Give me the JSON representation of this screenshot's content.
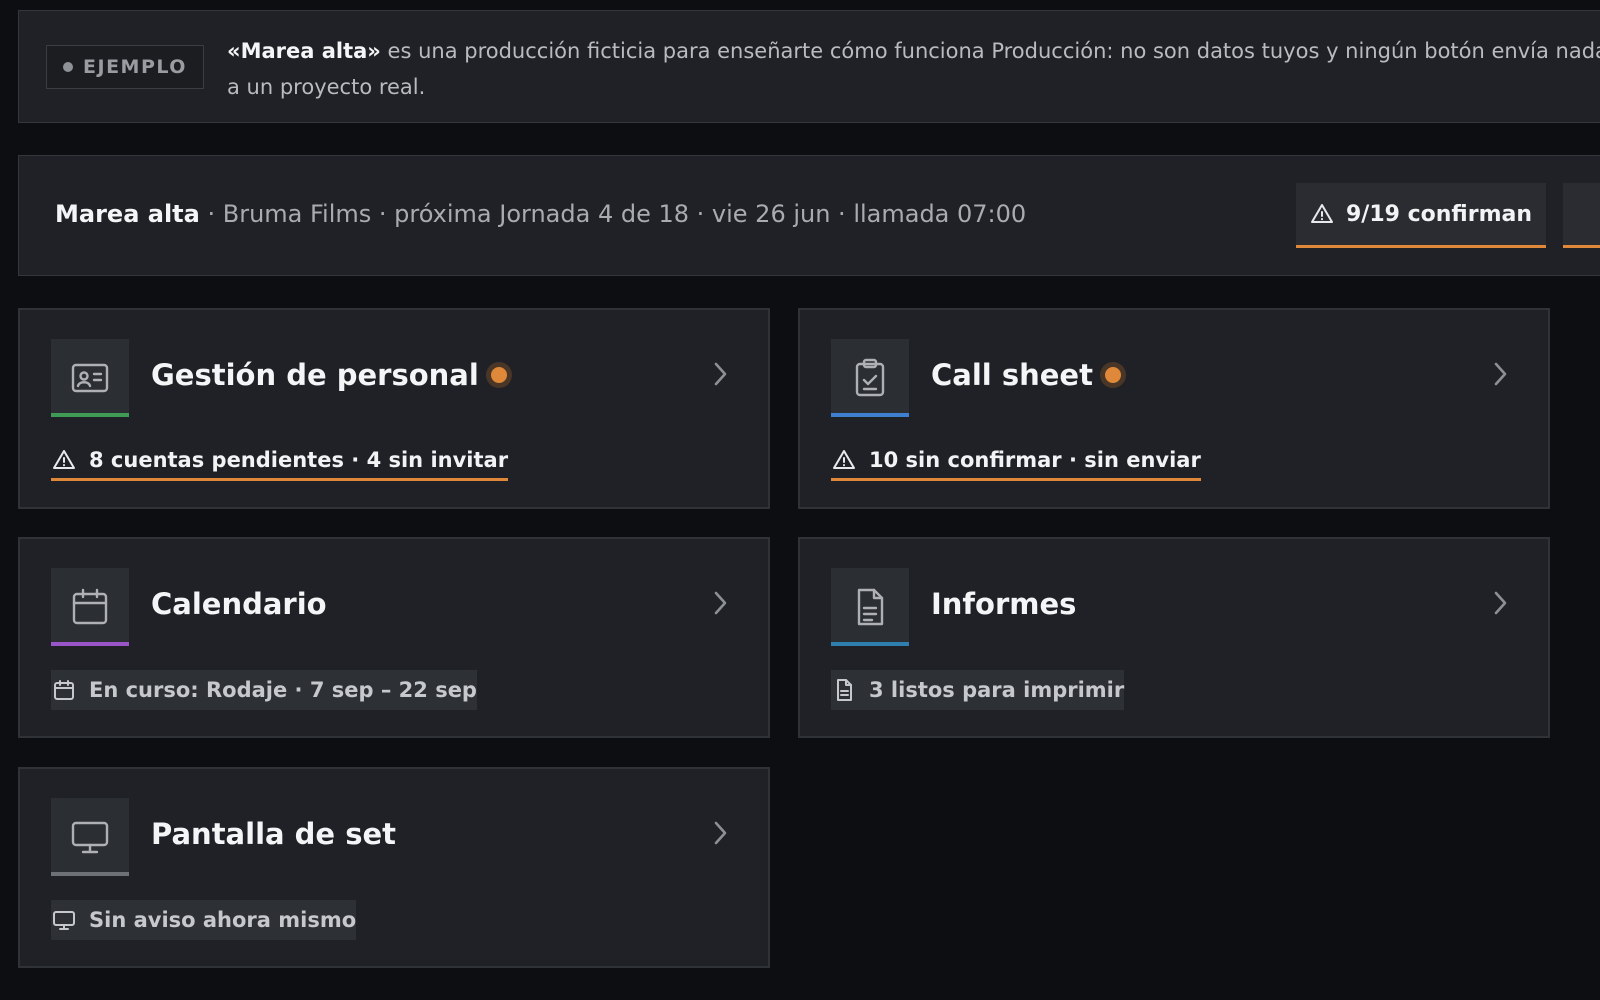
{
  "banner": {
    "chip_label": "EJEMPLO",
    "text_bold": "«Marea alta»",
    "text_rest": " es una producción ficticia para enseñarte cómo funciona Producción: no son datos tuyos y ningún botón envía nada a un proyecto real."
  },
  "header": {
    "project": "Marea alta",
    "details": " · Bruma Films · próxima Jornada 4 de 18 · vie 26 jun · llamada 07:00",
    "confirm_badge": "9/19 confirman"
  },
  "cards": [
    {
      "title": "Gestión de personal",
      "status": "8 cuentas pendientes · 4 sin invitar",
      "icon": "id-card-icon",
      "accent": "#3f9a55",
      "has_alert_dot": true
    },
    {
      "title": "Call sheet",
      "status": "10 sin confirmar · sin enviar",
      "icon": "clipboard-check-icon",
      "accent": "#3f7fcf",
      "has_alert_dot": true
    },
    {
      "title": "Calendario",
      "status": "En curso: Rodaje · 7 sep – 22 sep",
      "icon": "calendar-icon",
      "accent": "#9a55c9",
      "has_alert_dot": false
    },
    {
      "title": "Informes",
      "status": "3 listos para imprimir",
      "icon": "document-icon",
      "accent": "#2f7fae",
      "has_alert_dot": false
    },
    {
      "title": "Pantalla de set",
      "status": "Sin aviso ahora mismo",
      "icon": "monitor-icon",
      "accent": "#6e7176",
      "has_alert_dot": false
    }
  ],
  "colors": {
    "background": "#0c0e11",
    "surface": "#1f2126",
    "warning": "#e0883a"
  }
}
